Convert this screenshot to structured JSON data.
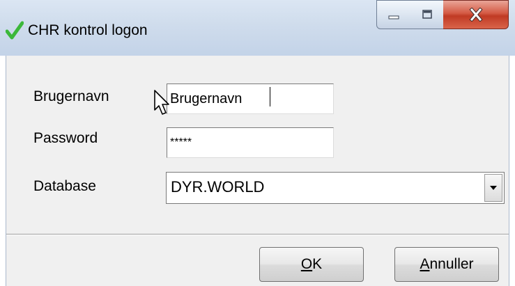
{
  "window": {
    "title": "CHR kontrol logon",
    "app_icon": "checkmark-icon",
    "controls": [
      "minimize-icon",
      "maximize-icon",
      "close-icon"
    ]
  },
  "form": {
    "username_label": "Brugernavn",
    "username_value": "Brugernavn",
    "password_label": "Password",
    "password_value": "*****",
    "database_label": "Database",
    "database_value": "DYR.WORLD"
  },
  "buttons": {
    "ok_accel": "O",
    "ok_rest": "K",
    "cancel_accel": "A",
    "cancel_rest": "nnuller"
  },
  "colors": {
    "check": "#3cb83a",
    "close_red": "#c9452e"
  }
}
